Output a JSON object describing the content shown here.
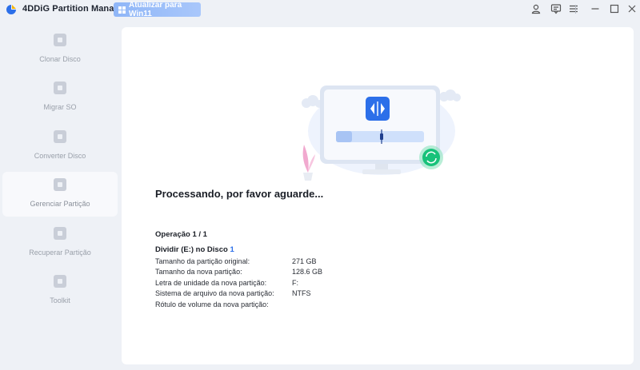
{
  "app": {
    "title": "4DDiG Partition Manager",
    "upgrade_label": "Atualizar para Win11",
    "accent": "#2c6fe9"
  },
  "titlebar_icons": [
    "user-icon",
    "feedback-icon",
    "menu-icon",
    "minimize-icon",
    "maximize-icon",
    "close-icon"
  ],
  "sidebar": {
    "items": [
      {
        "label": "Clonar Disco",
        "icon": "clone-disk-icon",
        "active": false
      },
      {
        "label": "Migrar SO",
        "icon": "migrate-os-icon",
        "active": false
      },
      {
        "label": "Converter Disco",
        "icon": "convert-disk-icon",
        "active": false
      },
      {
        "label": "Gerenciar Partição",
        "icon": "partition-icon",
        "active": true
      },
      {
        "label": "Recuperar Partição",
        "icon": "recover-partition-icon",
        "active": false
      },
      {
        "label": "Toolkit",
        "icon": "toolkit-icon",
        "active": false
      }
    ]
  },
  "main": {
    "processing_text": "Processando,  por favor aguarde...",
    "operation_count": "Operação 1 / 1",
    "operation_title": "Dividir (E:) no Disco ",
    "operation_disk": "1",
    "details": [
      {
        "key": "Tamanho da partição original:",
        "value": "271 GB"
      },
      {
        "key": "Tamanho da nova partição:",
        "value": "128.6 GB"
      },
      {
        "key": "Letra de unidade da nova partição:",
        "value": "F:"
      },
      {
        "key": "Sistema de arquivo da nova partição:",
        "value": "NTFS"
      },
      {
        "key": "Rótulo de volume da nova partição:",
        "value": ""
      }
    ]
  }
}
